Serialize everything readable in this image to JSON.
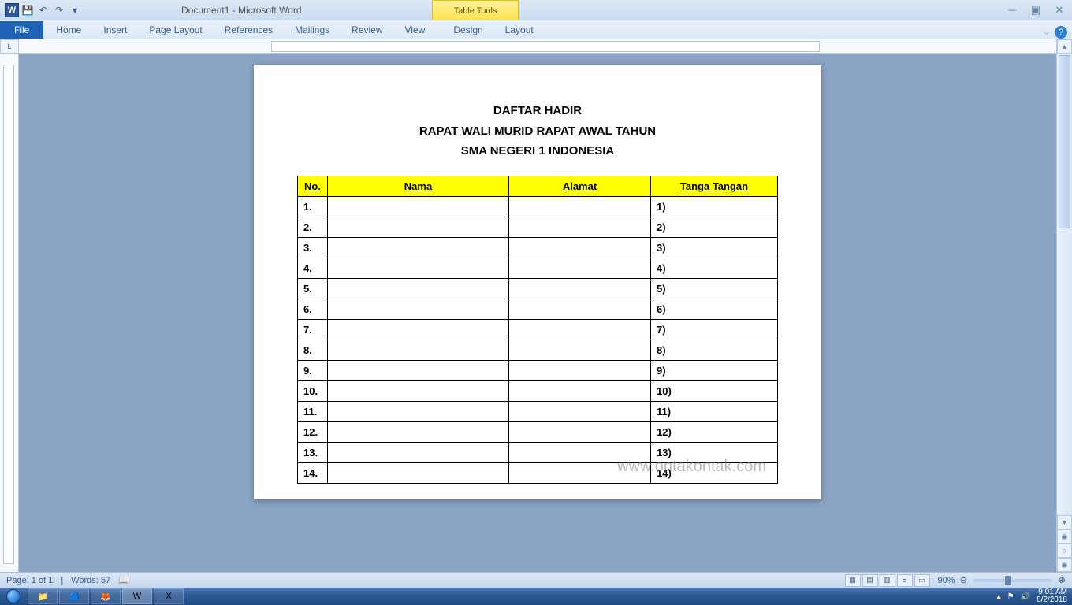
{
  "titlebar": {
    "doc_title": "Document1 - Microsoft Word",
    "table_tools": "Table Tools"
  },
  "tabs": {
    "file": "File",
    "home": "Home",
    "insert": "Insert",
    "pagelayout": "Page Layout",
    "references": "References",
    "mailings": "Mailings",
    "review": "Review",
    "view": "View",
    "design": "Design",
    "layout": "Layout"
  },
  "ruler_corner": "L",
  "document": {
    "title_line1": "DAFTAR HADIR",
    "title_line2": "RAPAT WALI MURID RAPAT AWAL TAHUN",
    "title_line3": "SMA NEGERI 1 INDONESIA",
    "headers": {
      "no": "No.",
      "nama": "Nama",
      "alamat": "Alamat",
      "sign": "Tanga Tangan"
    },
    "rows": [
      {
        "no": "1.",
        "sign": "1)",
        "align": "left"
      },
      {
        "no": "2.",
        "sign": "2)",
        "align": "right"
      },
      {
        "no": "3.",
        "sign": "3)",
        "align": "left"
      },
      {
        "no": "4.",
        "sign": "4)",
        "align": "right"
      },
      {
        "no": "5.",
        "sign": "5)",
        "align": "left"
      },
      {
        "no": "6.",
        "sign": "6)",
        "align": "right"
      },
      {
        "no": "7.",
        "sign": "7)",
        "align": "left"
      },
      {
        "no": "8.",
        "sign": "8)",
        "align": "right"
      },
      {
        "no": "9.",
        "sign": "9)",
        "align": "left"
      },
      {
        "no": "10.",
        "sign": "10)",
        "align": "right"
      },
      {
        "no": "11.",
        "sign": "11)",
        "align": "left"
      },
      {
        "no": "12.",
        "sign": "12)",
        "align": "right"
      },
      {
        "no": "13.",
        "sign": "13)",
        "align": "left"
      },
      {
        "no": "14.",
        "sign": "14)",
        "align": "right"
      }
    ]
  },
  "watermark": "www.ontakontak.com",
  "statusbar": {
    "page": "Page: 1 of 1",
    "words": "Words: 57",
    "zoom": "90%"
  },
  "tray": {
    "time": "9:01 AM",
    "date": "8/2/2018"
  }
}
